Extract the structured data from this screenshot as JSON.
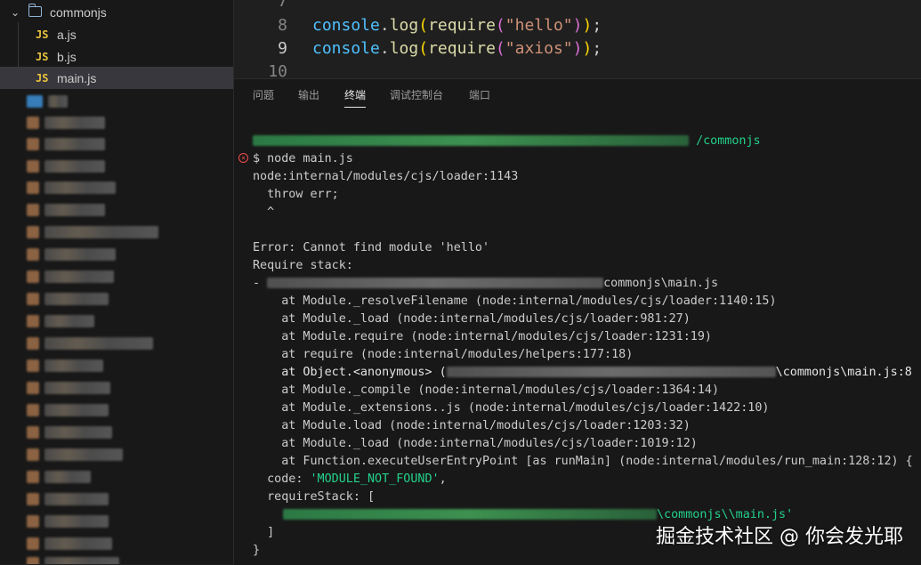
{
  "explorer": {
    "folder": "commonjs",
    "files": [
      {
        "icon": "JS",
        "name": "a.js"
      },
      {
        "icon": "JS",
        "name": "b.js"
      },
      {
        "icon": "JS",
        "name": "main.js"
      }
    ]
  },
  "editor": {
    "lines": [
      {
        "number": "7",
        "text": ""
      },
      {
        "number": "8",
        "var": "console",
        "dot": ".",
        "fn": "log",
        "open1": "(",
        "fn2": "require",
        "open2": "(",
        "str": "\"hello\"",
        "close2": ")",
        "close1": ")",
        "semi": ";"
      },
      {
        "number": "9",
        "var": "console",
        "dot": ".",
        "fn": "log",
        "open1": "(",
        "fn2": "require",
        "open2": "(",
        "str": "\"axios\"",
        "close2": ")",
        "close1": ")",
        "semi": ";"
      },
      {
        "number": "10",
        "text": ""
      }
    ]
  },
  "panel": {
    "tabs": [
      "问题",
      "输出",
      "终端",
      "调试控制台",
      "端口"
    ],
    "active_tab": "终端"
  },
  "terminal": {
    "path_suffix": "/commonjs",
    "prompt": "$ node main.js",
    "lines": [
      "node:internal/modules/cjs/loader:1143",
      "  throw err;",
      "  ^",
      "",
      "Error: Cannot find module 'hello'",
      "Require stack:"
    ],
    "stack_entry_prefix": "- ",
    "stack_entry_suffix": "commonjs\\main.js",
    "trace": [
      "    at Module._resolveFilename (node:internal/modules/cjs/loader:1140:15)",
      "    at Module._load (node:internal/modules/cjs/loader:981:27)",
      "    at Module.require (node:internal/modules/cjs/loader:1231:19)",
      "    at require (node:internal/modules/helpers:177:18)"
    ],
    "anon_prefix": "    at Object.<anonymous> (",
    "anon_suffix": "\\commonjs\\main.js:8",
    "trace2": [
      "    at Module._compile (node:internal/modules/cjs/loader:1364:14)",
      "    at Module._extensions..js (node:internal/modules/cjs/loader:1422:10)",
      "    at Module.load (node:internal/modules/cjs/loader:1203:32)",
      "    at Module._load (node:internal/modules/cjs/loader:1019:12)",
      "    at Function.executeUserEntryPoint [as runMain] (node:internal/modules/run_main:128:12) {"
    ],
    "code_key": "  code: ",
    "code_value": "'MODULE_NOT_FOUND'",
    "code_comma": ",",
    "require_stack_open": "  requireStack: [",
    "require_stack_value_suffix": "\\commonjs\\\\main.js'",
    "require_stack_close": "  ]",
    "close_brace": "}"
  },
  "watermark": "掘金技术社区 @ 你会发光耶"
}
